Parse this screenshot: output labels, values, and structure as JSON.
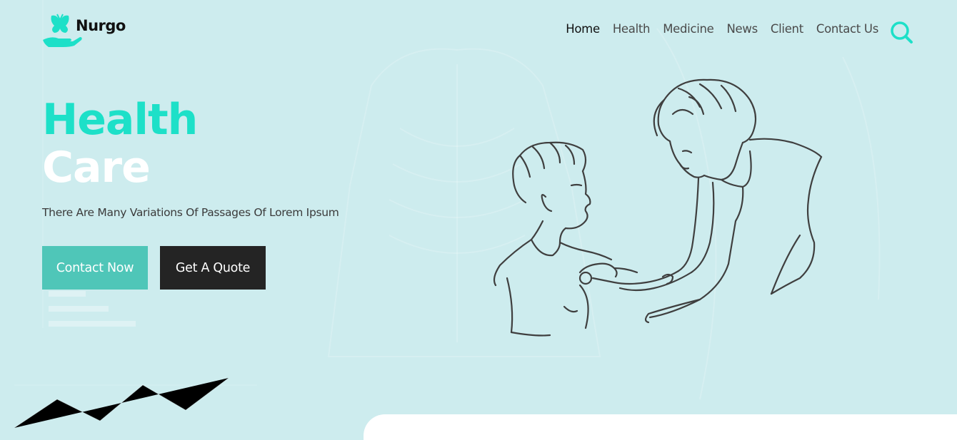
{
  "brand": {
    "name": "Nurgo",
    "logo_icon": "butterfly-hand-icon",
    "accent_color": "#1de0c8"
  },
  "nav": {
    "items": [
      {
        "label": "Home",
        "active": true
      },
      {
        "label": "Health",
        "active": false
      },
      {
        "label": "Medicine",
        "active": false
      },
      {
        "label": "News",
        "active": false
      },
      {
        "label": "Client",
        "active": false
      },
      {
        "label": "Contact Us",
        "active": false
      }
    ],
    "search_icon": "search-icon"
  },
  "hero": {
    "title_line1": "Health",
    "title_line2": "Care",
    "subtitle": "There Are Many Variations Of Passages Of Lorem Ipsum",
    "buttons": {
      "primary": "Contact Now",
      "secondary": "Get A Quote"
    },
    "illustration": "doctor-examining-boy-illustration",
    "background_color": "#cdecee"
  }
}
